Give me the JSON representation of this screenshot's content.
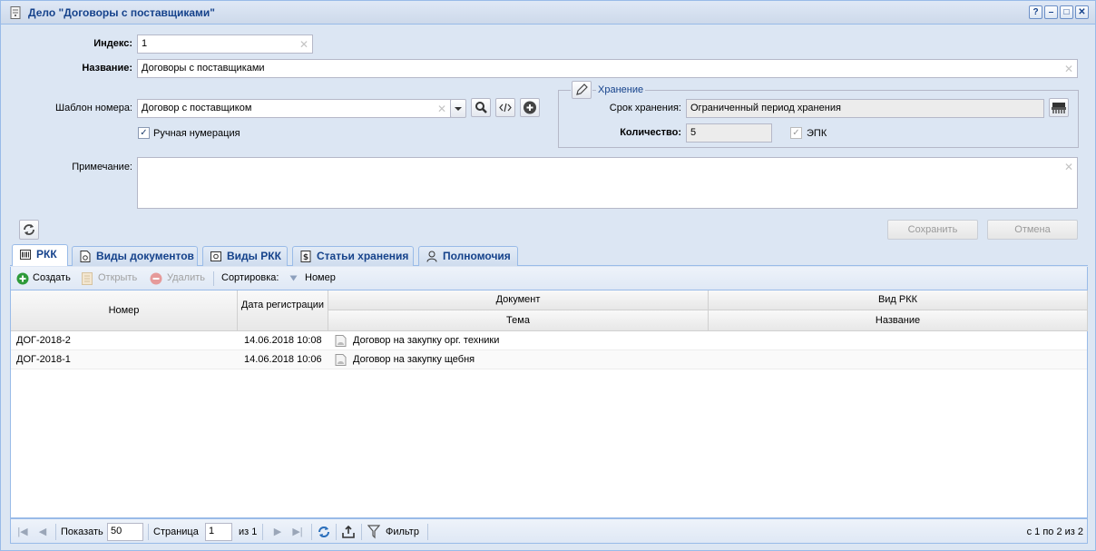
{
  "window": {
    "title": "Дело \"Договоры с поставщиками\"",
    "tools": [
      "?",
      "–",
      "□",
      "✕"
    ]
  },
  "form": {
    "index_label": "Индекс:",
    "index_value": "1",
    "name_label": "Название:",
    "name_value": "Договоры с поставщиками",
    "template_label": "Шаблон номера:",
    "template_value": "Договор с поставщиком",
    "manual_numbering_label": "Ручная нумерация",
    "manual_numbering_checked": true,
    "note_label": "Примечание:",
    "note_value": ""
  },
  "storage": {
    "legend": "Хранение",
    "period_label": "Срок хранения:",
    "period_value": "Ограниченный период хранения",
    "quantity_label": "Количество:",
    "quantity_value": "5",
    "epk_label": "ЭПК",
    "epk_checked": true
  },
  "actions": {
    "save": "Сохранить",
    "cancel": "Отмена"
  },
  "tabs": [
    {
      "label": "РКК",
      "icon": "barcode-icon",
      "active": true
    },
    {
      "label": "Виды документов",
      "icon": "document-gear-icon",
      "active": false
    },
    {
      "label": "Виды РКК",
      "icon": "card-gear-icon",
      "active": false
    },
    {
      "label": "Статьи хранения",
      "icon": "article-icon",
      "active": false
    },
    {
      "label": "Полномочия",
      "icon": "user-key-icon",
      "active": false
    }
  ],
  "toolbar": {
    "create": "Создать",
    "open": "Открыть",
    "delete": "Удалить",
    "sort_label": "Сортировка:",
    "sort_field": "Номер"
  },
  "grid": {
    "headers": {
      "number": "Номер",
      "reg_date": "Дата регистрации",
      "document": "Документ",
      "topic": "Тема",
      "rkk_type": "Вид РКК",
      "name": "Название"
    },
    "rows": [
      {
        "number": "ДОГ-2018-2",
        "date": "14.06.2018 10:08",
        "topic": "Договор на закупку орг. техники",
        "name": ""
      },
      {
        "number": "ДОГ-2018-1",
        "date": "14.06.2018 10:06",
        "topic": "Договор на закупку щебня",
        "name": ""
      }
    ]
  },
  "pager": {
    "show_label": "Показать",
    "page_size": "50",
    "page_label": "Страница",
    "page": "1",
    "of_label": "из 1",
    "filter": "Фильтр",
    "summary": "с 1 по 2 из 2"
  },
  "colors": {
    "window_bg": "#dce6f3",
    "title_text": "#15428b",
    "border": "#99bbe8",
    "create_green": "#2e9a3a",
    "delete_red": "#d9534f"
  }
}
